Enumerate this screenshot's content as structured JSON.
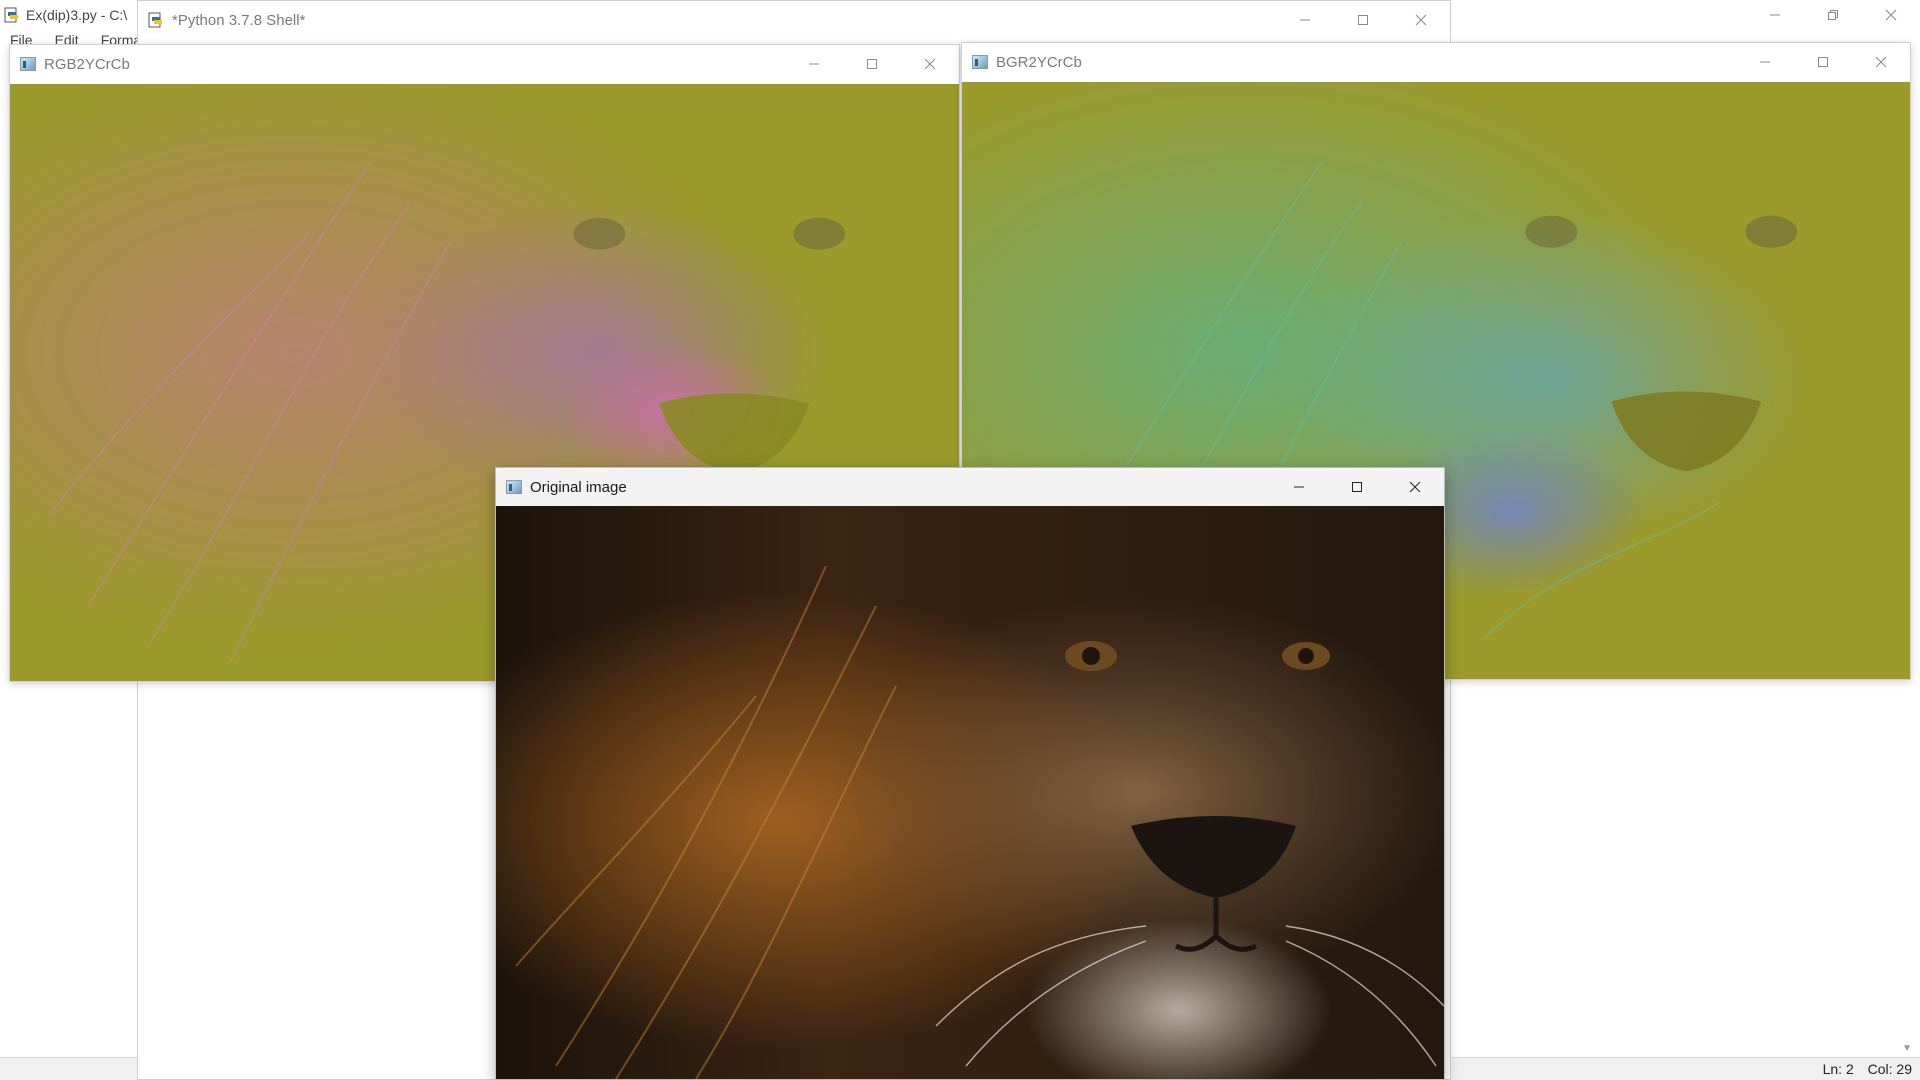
{
  "editor": {
    "title": "Ex(dip)3.py - C:\\",
    "menu": [
      "File",
      "Edit",
      "Forma"
    ],
    "status": {
      "ln": "Ln: 2",
      "col": "Col: 29"
    }
  },
  "shell": {
    "title": "*Python 3.7.8 Shell*"
  },
  "rgb_window": {
    "title": "RGB2YCrCb"
  },
  "bgr_window": {
    "title": "BGR2YCrCb"
  },
  "original_window": {
    "title": "Original image"
  },
  "icons": {
    "python": "python-file-icon",
    "opencv": "opencv-window-icon",
    "minimize": "minimize-icon",
    "maximize": "maximize-icon",
    "restore": "restore-icon",
    "close": "close-icon"
  }
}
